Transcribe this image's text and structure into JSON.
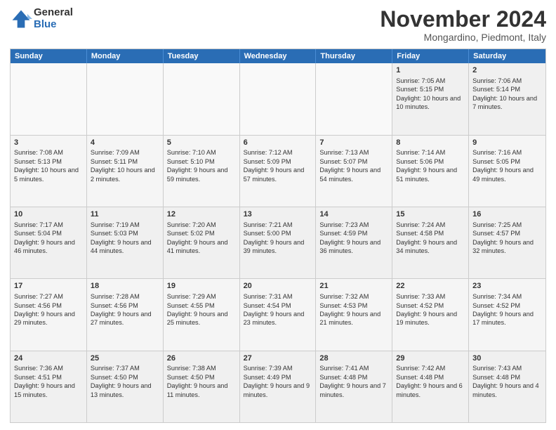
{
  "logo": {
    "general": "General",
    "blue": "Blue"
  },
  "header": {
    "month": "November 2024",
    "location": "Mongardino, Piedmont, Italy"
  },
  "weekdays": [
    "Sunday",
    "Monday",
    "Tuesday",
    "Wednesday",
    "Thursday",
    "Friday",
    "Saturday"
  ],
  "rows": [
    [
      {
        "day": "",
        "info": "",
        "empty": true
      },
      {
        "day": "",
        "info": "",
        "empty": true
      },
      {
        "day": "",
        "info": "",
        "empty": true
      },
      {
        "day": "",
        "info": "",
        "empty": true
      },
      {
        "day": "",
        "info": "",
        "empty": true
      },
      {
        "day": "1",
        "info": "Sunrise: 7:05 AM\nSunset: 5:15 PM\nDaylight: 10 hours and 10 minutes.",
        "empty": false
      },
      {
        "day": "2",
        "info": "Sunrise: 7:06 AM\nSunset: 5:14 PM\nDaylight: 10 hours and 7 minutes.",
        "empty": false
      }
    ],
    [
      {
        "day": "3",
        "info": "Sunrise: 7:08 AM\nSunset: 5:13 PM\nDaylight: 10 hours and 5 minutes.",
        "empty": false
      },
      {
        "day": "4",
        "info": "Sunrise: 7:09 AM\nSunset: 5:11 PM\nDaylight: 10 hours and 2 minutes.",
        "empty": false
      },
      {
        "day": "5",
        "info": "Sunrise: 7:10 AM\nSunset: 5:10 PM\nDaylight: 9 hours and 59 minutes.",
        "empty": false
      },
      {
        "day": "6",
        "info": "Sunrise: 7:12 AM\nSunset: 5:09 PM\nDaylight: 9 hours and 57 minutes.",
        "empty": false
      },
      {
        "day": "7",
        "info": "Sunrise: 7:13 AM\nSunset: 5:07 PM\nDaylight: 9 hours and 54 minutes.",
        "empty": false
      },
      {
        "day": "8",
        "info": "Sunrise: 7:14 AM\nSunset: 5:06 PM\nDaylight: 9 hours and 51 minutes.",
        "empty": false
      },
      {
        "day": "9",
        "info": "Sunrise: 7:16 AM\nSunset: 5:05 PM\nDaylight: 9 hours and 49 minutes.",
        "empty": false
      }
    ],
    [
      {
        "day": "10",
        "info": "Sunrise: 7:17 AM\nSunset: 5:04 PM\nDaylight: 9 hours and 46 minutes.",
        "empty": false
      },
      {
        "day": "11",
        "info": "Sunrise: 7:19 AM\nSunset: 5:03 PM\nDaylight: 9 hours and 44 minutes.",
        "empty": false
      },
      {
        "day": "12",
        "info": "Sunrise: 7:20 AM\nSunset: 5:02 PM\nDaylight: 9 hours and 41 minutes.",
        "empty": false
      },
      {
        "day": "13",
        "info": "Sunrise: 7:21 AM\nSunset: 5:00 PM\nDaylight: 9 hours and 39 minutes.",
        "empty": false
      },
      {
        "day": "14",
        "info": "Sunrise: 7:23 AM\nSunset: 4:59 PM\nDaylight: 9 hours and 36 minutes.",
        "empty": false
      },
      {
        "day": "15",
        "info": "Sunrise: 7:24 AM\nSunset: 4:58 PM\nDaylight: 9 hours and 34 minutes.",
        "empty": false
      },
      {
        "day": "16",
        "info": "Sunrise: 7:25 AM\nSunset: 4:57 PM\nDaylight: 9 hours and 32 minutes.",
        "empty": false
      }
    ],
    [
      {
        "day": "17",
        "info": "Sunrise: 7:27 AM\nSunset: 4:56 PM\nDaylight: 9 hours and 29 minutes.",
        "empty": false
      },
      {
        "day": "18",
        "info": "Sunrise: 7:28 AM\nSunset: 4:56 PM\nDaylight: 9 hours and 27 minutes.",
        "empty": false
      },
      {
        "day": "19",
        "info": "Sunrise: 7:29 AM\nSunset: 4:55 PM\nDaylight: 9 hours and 25 minutes.",
        "empty": false
      },
      {
        "day": "20",
        "info": "Sunrise: 7:31 AM\nSunset: 4:54 PM\nDaylight: 9 hours and 23 minutes.",
        "empty": false
      },
      {
        "day": "21",
        "info": "Sunrise: 7:32 AM\nSunset: 4:53 PM\nDaylight: 9 hours and 21 minutes.",
        "empty": false
      },
      {
        "day": "22",
        "info": "Sunrise: 7:33 AM\nSunset: 4:52 PM\nDaylight: 9 hours and 19 minutes.",
        "empty": false
      },
      {
        "day": "23",
        "info": "Sunrise: 7:34 AM\nSunset: 4:52 PM\nDaylight: 9 hours and 17 minutes.",
        "empty": false
      }
    ],
    [
      {
        "day": "24",
        "info": "Sunrise: 7:36 AM\nSunset: 4:51 PM\nDaylight: 9 hours and 15 minutes.",
        "empty": false
      },
      {
        "day": "25",
        "info": "Sunrise: 7:37 AM\nSunset: 4:50 PM\nDaylight: 9 hours and 13 minutes.",
        "empty": false
      },
      {
        "day": "26",
        "info": "Sunrise: 7:38 AM\nSunset: 4:50 PM\nDaylight: 9 hours and 11 minutes.",
        "empty": false
      },
      {
        "day": "27",
        "info": "Sunrise: 7:39 AM\nSunset: 4:49 PM\nDaylight: 9 hours and 9 minutes.",
        "empty": false
      },
      {
        "day": "28",
        "info": "Sunrise: 7:41 AM\nSunset: 4:48 PM\nDaylight: 9 hours and 7 minutes.",
        "empty": false
      },
      {
        "day": "29",
        "info": "Sunrise: 7:42 AM\nSunset: 4:48 PM\nDaylight: 9 hours and 6 minutes.",
        "empty": false
      },
      {
        "day": "30",
        "info": "Sunrise: 7:43 AM\nSunset: 4:48 PM\nDaylight: 9 hours and 4 minutes.",
        "empty": false
      }
    ]
  ]
}
